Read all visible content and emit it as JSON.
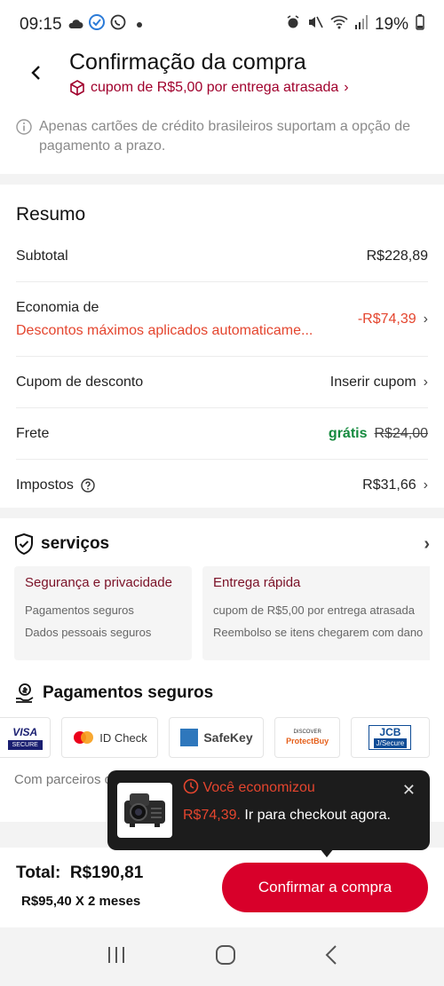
{
  "status": {
    "time": "09:15",
    "battery": "19%"
  },
  "header": {
    "title": "Confirmação da compra",
    "coupon": "cupom de R$5,00 por entrega atrasada",
    "coupon_chev": "›"
  },
  "notice": {
    "text": "Apenas cartões de crédito brasileiros suportam a opção de pagamento a prazo."
  },
  "resumo": {
    "title": "Resumo",
    "subtotal_label": "Subtotal",
    "subtotal_value": "R$228,89",
    "economia_label": "Economia de",
    "economia_desc": "Descontos máximos aplicados automaticame...",
    "economia_value": "-R$74,39",
    "cupom_label": "Cupom de desconto",
    "cupom_action": "Inserir cupom",
    "frete_label": "Frete",
    "frete_free": "grátis",
    "frete_old": "R$24,00",
    "impostos_label": "Impostos",
    "impostos_value": "R$31,66"
  },
  "servicos": {
    "title": "serviços",
    "boxes": [
      {
        "title": "Segurança e privacidade",
        "line1": "Pagamentos seguros",
        "line2": "Dados pessoais seguros"
      },
      {
        "title": "Entrega rápida",
        "line1": "cupom de R$5,00 por entrega atrasada",
        "line2": "Reembolso se itens chegarem com dano"
      }
    ]
  },
  "pagamentos": {
    "title": "Pagamentos seguros",
    "badges": [
      "VISA",
      "SECURE",
      "ID Check",
      "SafeKey",
      "DISCOVER",
      "ProtectBuy",
      "JCB",
      "J/Secure"
    ],
    "text": "Com parceiros de pagamento, seus dados pessoais são seguros."
  },
  "toast": {
    "line1": "Você economizou",
    "amount": "R$74,39.",
    "rest": " Ir para checkout agora.",
    "close": "✕"
  },
  "bottom": {
    "total_label": "Total:",
    "total_value": "R$190,81",
    "installments": "R$95,40 X 2 meses",
    "confirm": "Confirmar a compra"
  },
  "colors": {
    "accent": "#d8002a",
    "discount": "#e4452e",
    "free": "#148a3e"
  }
}
